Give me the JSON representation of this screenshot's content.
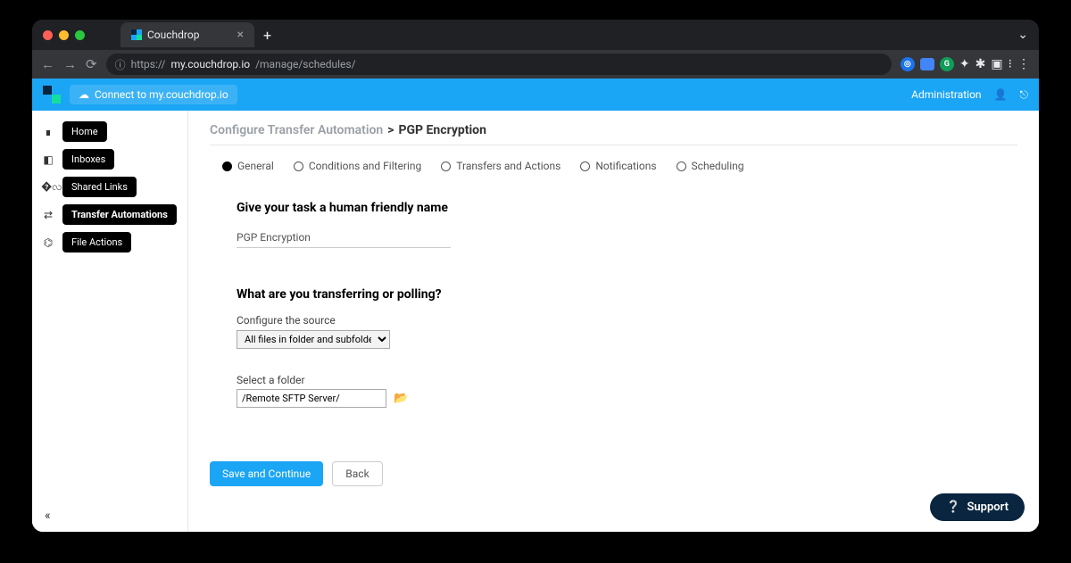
{
  "browser": {
    "tab_title": "Couchdrop",
    "url_scheme": "https://",
    "url_host": "my.couchdrop.io",
    "url_path": "/manage/schedules/"
  },
  "topbar": {
    "connect_label": "Connect to my.couchdrop.io",
    "admin_label": "Administration"
  },
  "sidebar": {
    "items": [
      {
        "label": "Home"
      },
      {
        "label": "Inboxes"
      },
      {
        "label": "Shared Links"
      },
      {
        "label": "Transfer Automations"
      },
      {
        "label": "File Actions"
      }
    ]
  },
  "breadcrumb": {
    "parent": "Configure Transfer Automation",
    "current": "PGP Encryption"
  },
  "steps": [
    {
      "label": "General"
    },
    {
      "label": "Conditions and Filtering"
    },
    {
      "label": "Transfers and Actions"
    },
    {
      "label": "Notifications"
    },
    {
      "label": "Scheduling"
    }
  ],
  "section_name": {
    "heading": "Give your task a human friendly name",
    "value": "PGP Encryption"
  },
  "section_source": {
    "heading": "What are you transferring or polling?",
    "configure_label": "Configure the source",
    "source_option": "All files in folder and subfolders",
    "folder_label": "Select a folder",
    "folder_value": "/Remote SFTP Server/"
  },
  "buttons": {
    "save": "Save and Continue",
    "back": "Back",
    "support": "Support"
  }
}
